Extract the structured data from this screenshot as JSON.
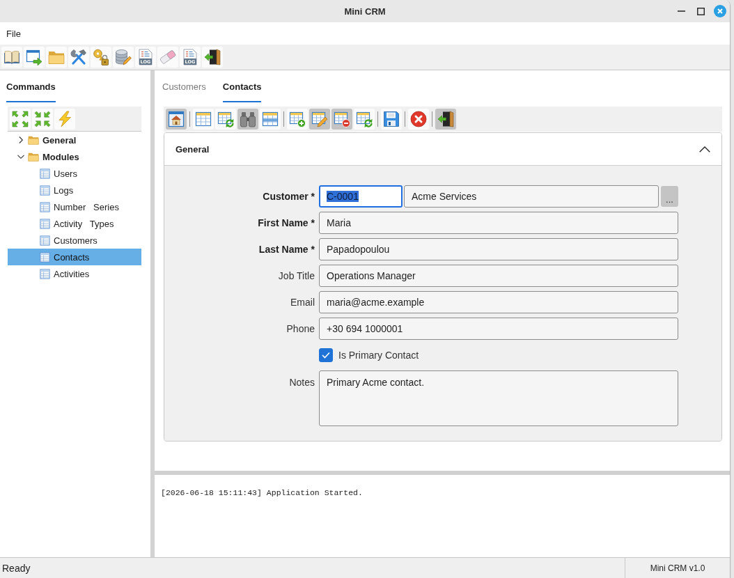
{
  "window": {
    "title": "Mini CRM"
  },
  "menu": [
    {
      "label": "File"
    }
  ],
  "toolbar": [
    {
      "kind": "book"
    },
    {
      "kind": "window"
    },
    {
      "kind": "folder"
    },
    {
      "kind": "tools"
    },
    {
      "kind": "key"
    },
    {
      "kind": "database"
    },
    {
      "kind": "log",
      "badge": "LOG"
    },
    {
      "kind": "eraser"
    },
    {
      "kind": "log",
      "badge": "LOG"
    },
    {
      "kind": "exit"
    }
  ],
  "sidebar": {
    "tabs": [
      {
        "label": "Commands",
        "selected": true
      }
    ],
    "tools": [
      {
        "kind": "expand"
      },
      {
        "kind": "collapse"
      },
      {
        "kind": "run"
      }
    ],
    "tree": [
      {
        "kind": "folder",
        "label": "General",
        "expanded": false,
        "selected": false
      },
      {
        "kind": "folder",
        "label": "Modules",
        "expanded": true,
        "selected": false,
        "children": [
          {
            "kind": "table",
            "label": "Users",
            "selected": false
          },
          {
            "kind": "table",
            "label": "Logs",
            "selected": false
          },
          {
            "kind": "table",
            "label": "Number   Series",
            "selected": false
          },
          {
            "kind": "table",
            "label": "Activity   Types",
            "selected": false
          },
          {
            "kind": "table",
            "label": "Customers",
            "selected": false
          },
          {
            "kind": "table",
            "label": "Contacts",
            "selected": true
          },
          {
            "kind": "table",
            "label": "Activities",
            "selected": false
          }
        ]
      }
    ]
  },
  "main": {
    "tabs": [
      {
        "label": "Customers",
        "selected": false
      },
      {
        "label": "Contacts",
        "selected": true
      }
    ],
    "toolbar": [
      {
        "kind": "home",
        "pressed": true
      },
      {
        "kind": "separator"
      },
      {
        "kind": "grid",
        "pressed": false
      },
      {
        "kind": "grid-refresh",
        "pressed": false
      },
      {
        "kind": "find",
        "pressed": true
      },
      {
        "kind": "grid-row",
        "pressed": false
      },
      {
        "kind": "separator"
      },
      {
        "kind": "grid-add",
        "pressed": false
      },
      {
        "kind": "grid-edit",
        "pressed": true
      },
      {
        "kind": "grid-delete",
        "pressed": true
      },
      {
        "kind": "grid-refresh",
        "pressed": false
      },
      {
        "kind": "separator"
      },
      {
        "kind": "save",
        "pressed": false
      },
      {
        "kind": "separator"
      },
      {
        "kind": "cancel",
        "pressed": false
      },
      {
        "kind": "separator"
      },
      {
        "kind": "exit",
        "pressed": true
      }
    ],
    "group": {
      "title": "General",
      "expanded": true,
      "fields": [
        {
          "kind": "lookup",
          "label": "Customer *",
          "required": true,
          "code": "C-0001",
          "focused": true,
          "value": "Acme Services",
          "button": "..."
        },
        {
          "kind": "text",
          "label": "First Name *",
          "required": true,
          "value": "Maria"
        },
        {
          "kind": "text",
          "label": "Last Name *",
          "required": true,
          "value": "Papadopoulou"
        },
        {
          "kind": "text",
          "label": "Job Title",
          "required": false,
          "value": "Operations Manager"
        },
        {
          "kind": "text",
          "label": "Email",
          "required": false,
          "value": "maria@acme.example"
        },
        {
          "kind": "text",
          "label": "Phone",
          "required": false,
          "value": "+30 694 1000001"
        },
        {
          "kind": "checkbox",
          "label": "Is Primary Contact",
          "checked": true
        },
        {
          "kind": "textarea",
          "label": "Notes",
          "required": false,
          "value": "Primary Acme contact."
        }
      ]
    }
  },
  "log": {
    "lines": [
      "[2026-06-18 15:11:43] Application Started."
    ]
  },
  "status_bar": {
    "message": "Ready",
    "version": "Mini CRM v1.0"
  }
}
